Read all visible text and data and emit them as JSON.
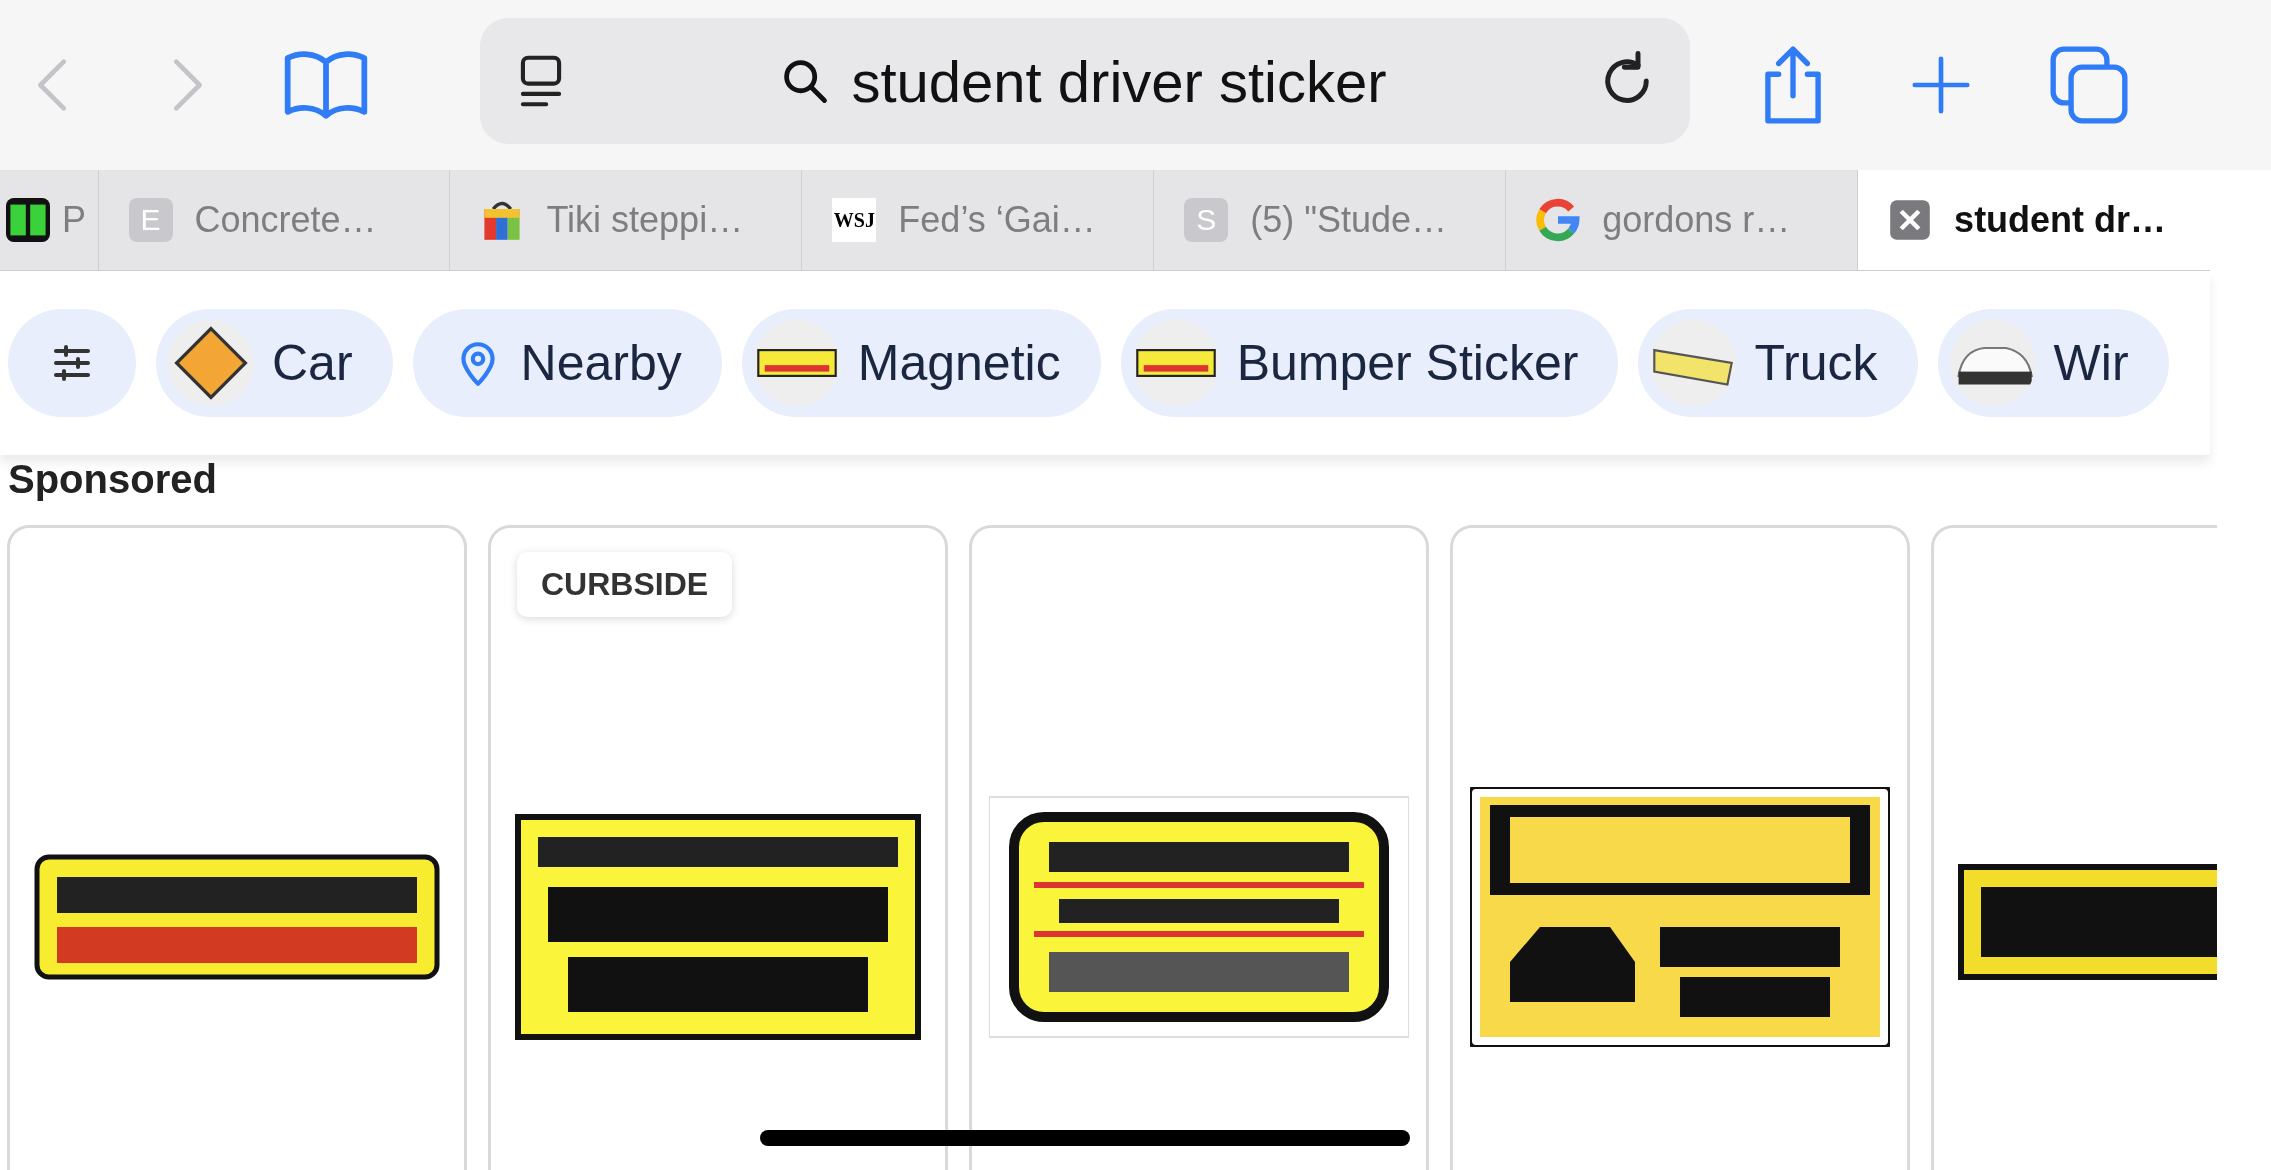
{
  "toolbar": {
    "search": {
      "value": "student driver sticker"
    }
  },
  "tabs": [
    {
      "label": "P",
      "kind": "block",
      "selected": false
    },
    {
      "label": "Concrete…",
      "kind": "letter",
      "letter": "E",
      "selected": false
    },
    {
      "label": "Tiki steppi…",
      "kind": "bag",
      "selected": false
    },
    {
      "label": "Fed’s ‘Gai…",
      "kind": "wordmark",
      "letter": "WSJ",
      "selected": false
    },
    {
      "label": "(5) \"Stude…",
      "kind": "letter",
      "letter": "S",
      "selected": false
    },
    {
      "label": "gordons r…",
      "kind": "ring",
      "selected": false
    },
    {
      "label": "student dr…",
      "kind": "close",
      "selected": true
    }
  ],
  "chips": [
    {
      "kind": "filter"
    },
    {
      "kind": "thumb",
      "label": "Car"
    },
    {
      "kind": "pin",
      "label": "Nearby"
    },
    {
      "kind": "thumb",
      "label": "Magnetic"
    },
    {
      "kind": "thumb",
      "label": "Bumper Sticker"
    },
    {
      "kind": "thumb",
      "label": "Truck"
    },
    {
      "kind": "thumb",
      "label": "Wir"
    }
  ],
  "section_title": "Sponsored",
  "cards": [
    {
      "kind": "picture"
    },
    {
      "kind": "picture",
      "badge": "CURBSIDE"
    },
    {
      "kind": "picture"
    },
    {
      "kind": "picture"
    },
    {
      "kind": "picture"
    }
  ]
}
